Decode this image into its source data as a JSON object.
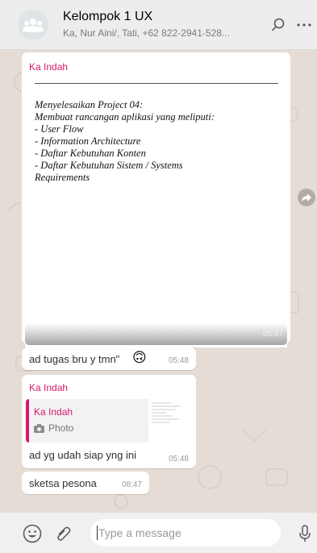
{
  "header": {
    "title": "Kelompok 1 UX",
    "subtitle": "Ka, Nur Aini/, Tati, +62 822-2941-528..."
  },
  "messages": {
    "doc_message": {
      "sender": "Ka Indah",
      "doc_lines": [
        "Menyelesaikan Project 04:",
        "Membuat rancangan aplikasi yang meliputi:",
        "- User Flow",
        "- Information Architecture",
        "- Daftar Kebutuhan Konten",
        "- Daftar Kebutuhan Sistem / Systems",
        "Requirements"
      ],
      "time": "05:47"
    },
    "msg2": {
      "text": "ad tugas bru y tmn\"",
      "emoji": "🙃",
      "time": "05:48"
    },
    "msg3": {
      "sender": "Ka Indah",
      "quote_sender": "Ka Indah",
      "quote_label": "Photo",
      "text": "ad yg udah siap yng ini",
      "time": "05:48"
    },
    "msg4": {
      "text": "sketsa pesona",
      "time": "08:47"
    }
  },
  "composer": {
    "placeholder": "Type a message"
  },
  "colors": {
    "sender_name": "#d3196d",
    "chat_background": "#e5ddd5",
    "header_background": "#ededed"
  },
  "icons": [
    "group-avatar-icon",
    "search-icon",
    "more-icon",
    "forward-icon",
    "emoji-icon",
    "attach-icon",
    "camera-icon",
    "microphone-icon"
  ]
}
